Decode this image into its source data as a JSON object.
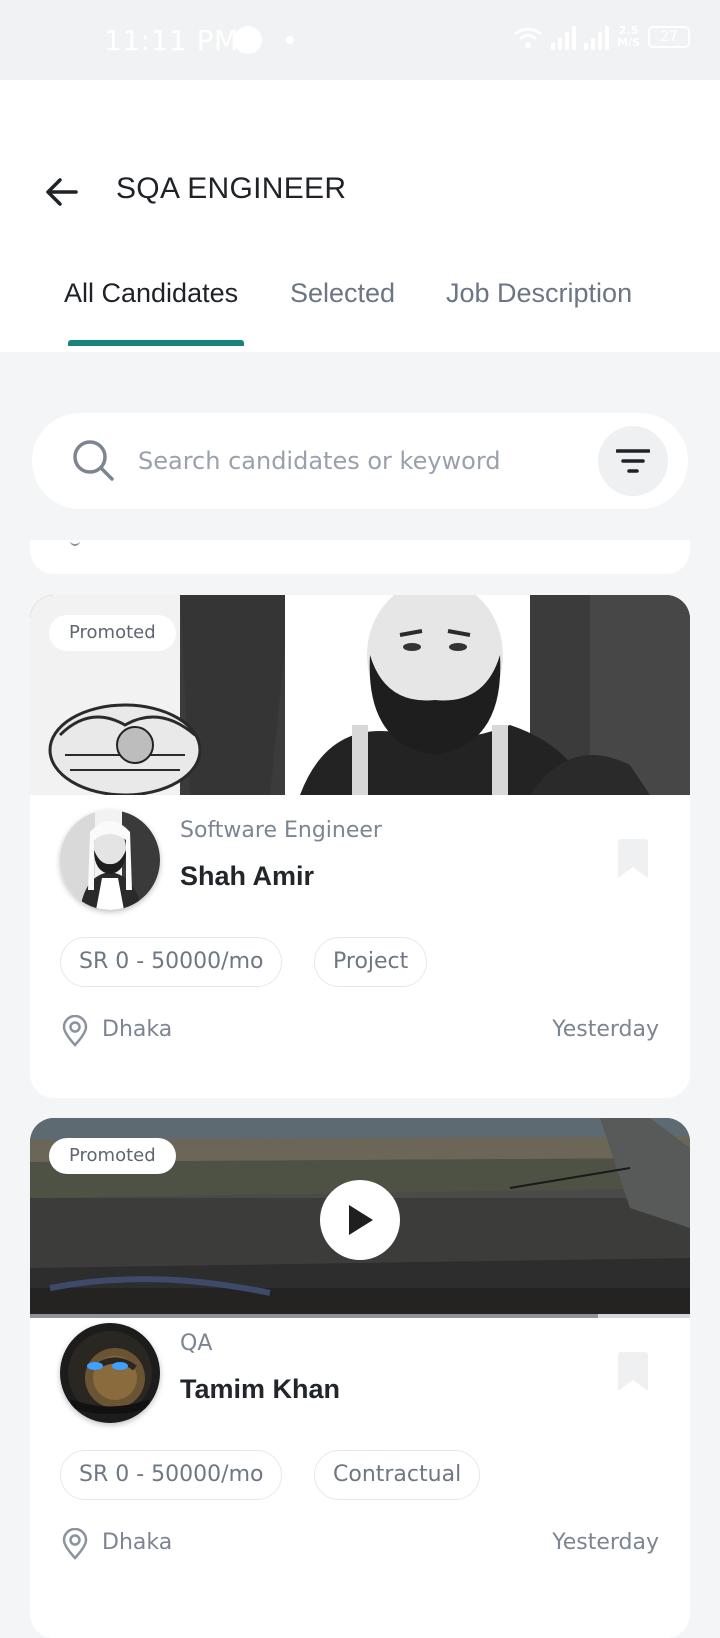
{
  "status_bar": {
    "time": "11:11 PM",
    "speed_value": "2.5",
    "speed_unit": "M/S",
    "battery": "27"
  },
  "header": {
    "title": "SQA ENGINEER",
    "back_icon": "arrow-left-icon"
  },
  "tabs": [
    {
      "label": "All Candidates",
      "active": true
    },
    {
      "label": "Selected",
      "active": false
    },
    {
      "label": "Job Description",
      "active": false
    }
  ],
  "search": {
    "placeholder": "Search candidates or keyword",
    "value": "",
    "icon": "search-icon",
    "filter_icon": "filter-icon"
  },
  "candidates": [
    {
      "badge": "Promoted",
      "media_type": "image",
      "role": "Software Engineer",
      "name": "Shah Amir",
      "salary": "SR 0 - 50000/mo",
      "job_type": "Project",
      "location": "Dhaka",
      "posted": "Yesterday"
    },
    {
      "badge": "Promoted",
      "media_type": "video",
      "video_progress": 0.86,
      "role": "QA",
      "name": "Tamim Khan",
      "salary": "SR 0 - 50000/mo",
      "job_type": "Contractual",
      "location": "Dhaka",
      "posted": "Yesterday"
    }
  ],
  "colors": {
    "accent": "#16847b",
    "background": "#f4f5f7",
    "card": "#ffffff"
  }
}
